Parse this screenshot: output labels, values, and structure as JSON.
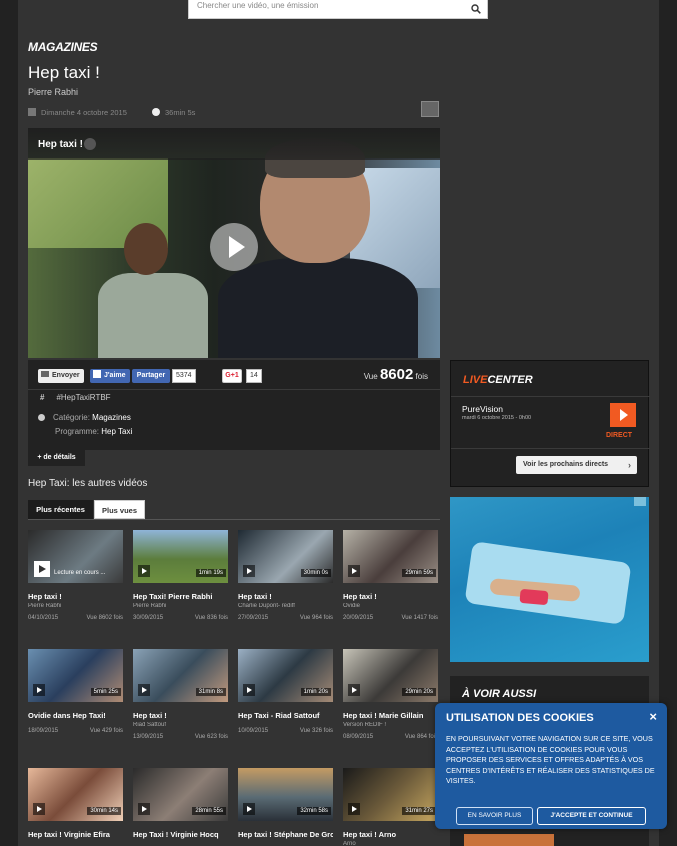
{
  "search": {
    "placeholder": "Chercher une vidéo, une émission"
  },
  "section": "MAGAZINES",
  "video": {
    "title": "Hep taxi !",
    "subtitle": "Pierre Rabhi",
    "date": "Dimanche 4 octobre 2015",
    "duration": "36min 5s",
    "player_title": "Hep taxi !"
  },
  "social": {
    "envoyer": "Envoyer",
    "jaime": "J'aime",
    "partager": "Partager",
    "fb_count": "5374",
    "gplus": "G+1",
    "gplus_count": "14"
  },
  "views": {
    "label": "Vue",
    "count": "8602",
    "suffix": "fois"
  },
  "hashtag": {
    "symbol": "#",
    "text": "#HepTaxiRTBF"
  },
  "category": {
    "label": "Catégorie:",
    "value": "Magazines"
  },
  "programme": {
    "label": "Programme:",
    "value": "Hep Taxi"
  },
  "details_button": "+ de détails",
  "other_videos": {
    "title": "Hep Taxi: les autres vidéos",
    "tabs": [
      "Plus récentes",
      "Plus vues"
    ],
    "items": [
      {
        "title": "Hep taxi !",
        "author": "Pierre Rabhi",
        "date": "04/10/2015",
        "views": "Vue 8602 fois",
        "duration": "",
        "playing": "Lecture en cours ..."
      },
      {
        "title": "Hep Taxi! Pierre Rabhi",
        "author": "Pierre Rabhi",
        "date": "30/09/2015",
        "views": "Vue 836 fois",
        "duration": "1min 19s"
      },
      {
        "title": "Hep taxi !",
        "author": "Charlie Dupont- rediff",
        "date": "27/09/2015",
        "views": "Vue 964 fois",
        "duration": "30min 0s"
      },
      {
        "title": "Hep taxi !",
        "author": "Ovidie",
        "date": "20/09/2015",
        "views": "Vue 1417 fois",
        "duration": "29min 59s"
      },
      {
        "title": "Ovidie dans Hep Taxi!",
        "author": "",
        "date": "18/09/2015",
        "views": "Vue 429 fois",
        "duration": "5min 25s"
      },
      {
        "title": "Hep taxi !",
        "author": "Riad Sattouf",
        "date": "13/09/2015",
        "views": "Vue 623 fois",
        "duration": "31min 8s"
      },
      {
        "title": "Hep Taxi - Riad Sattouf",
        "author": "",
        "date": "10/09/2015",
        "views": "Vue 326 fois",
        "duration": "1min 20s"
      },
      {
        "title": "Hep taxi ! Marie Gillain",
        "author": "Version REDIF !",
        "date": "08/09/2015",
        "views": "Vue 864 fois",
        "duration": "29min 20s"
      },
      {
        "title": "Hep taxi ! Virginie Efira",
        "author": "",
        "date": "",
        "views": "",
        "duration": "30min 14s"
      },
      {
        "title": "Hep Taxi ! Virginie Hocq",
        "author": "",
        "date": "",
        "views": "",
        "duration": "28min 55s"
      },
      {
        "title": "Hep taxi ! Stéphane De Groodt",
        "author": "",
        "date": "",
        "views": "",
        "duration": "32min 58s"
      },
      {
        "title": "Hep taxi ! Arno",
        "author": "Arno",
        "date": "",
        "views": "",
        "duration": "31min 27s"
      }
    ]
  },
  "livecenter": {
    "prefix": "LIVE",
    "suffix": "CENTER",
    "channel": "PureVision",
    "datetime": "mardi 6 octobre 2015 - 0h00",
    "direct": "DIRECT",
    "next_button": "Voir les prochains directs"
  },
  "voir_aussi": "À VOIR AUSSI",
  "cookie": {
    "title": "UTILISATION DES COOKIES",
    "close": "×",
    "text": "EN POURSUIVANT VOTRE NAVIGATION SUR CE SITE, VOUS ACCEPTEZ L'UTILISATION DE COOKIES POUR VOUS PROPOSER DES SERVICES ET OFFRES ADAPTÉS À VOS CENTRES D'INTÉRÊTS ET RÉALISER DES STATISTIQUES DE VISITES.",
    "more": "EN SAVOIR PLUS",
    "accept": "J'ACCEPTE ET CONTINUE"
  },
  "colors": {
    "accent": "#f15a22",
    "facebook": "#4267b2",
    "cookie_bg": "#1e5aa0"
  }
}
